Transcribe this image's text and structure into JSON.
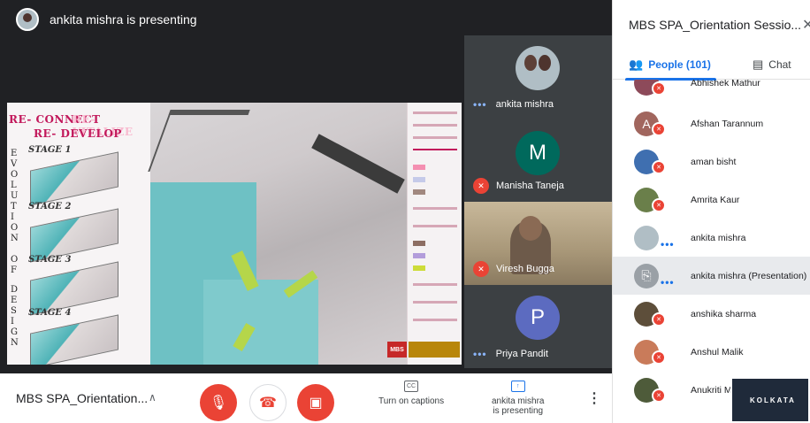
{
  "presenter": {
    "text": "ankita mishra is presenting"
  },
  "slide": {
    "title_line1a": "RE- CONNECT",
    "title_line1b": "RE- VITALIZE",
    "title_line2": "RE- DEVELOP",
    "vertical_letters": [
      "E",
      "V",
      "O",
      "L",
      "U",
      "T",
      "I",
      "O",
      "N",
      "O",
      "F",
      "D",
      "E",
      "S",
      "I",
      "G",
      "N"
    ],
    "stages": [
      "STAGE 1",
      "STAGE 2",
      "STAGE 3",
      "STAGE 4"
    ],
    "logo_text": "MBS"
  },
  "tiles": [
    {
      "name": "ankita mishra",
      "kind": "photo",
      "status": "dots"
    },
    {
      "name": "Manisha Taneja",
      "kind": "letter",
      "letter": "M",
      "color": "#00695c",
      "status": "muted"
    },
    {
      "name": "Viresh Bugga",
      "kind": "video",
      "status": "muted"
    },
    {
      "name": "Priya Pandit",
      "kind": "letter",
      "letter": "P",
      "color": "#5c6bc0",
      "status": "dots"
    }
  ],
  "side": {
    "title": "MBS SPA_Orientation Sessio...",
    "close_icon": "close-icon",
    "tab_people": "People (101)",
    "tab_chat": "Chat",
    "participants": [
      {
        "name": "Abhishek Mathur",
        "avatar_color": "#8d4a5a",
        "initial": "",
        "status": "muted"
      },
      {
        "name": "Afshan Tarannum",
        "avatar_color": "#a1665e",
        "initial": "A",
        "status": "muted"
      },
      {
        "name": "aman bisht",
        "avatar_color": "#3f6fb0",
        "initial": "",
        "status": "muted"
      },
      {
        "name": "Amrita Kaur",
        "avatar_color": "#6a7f4a",
        "initial": "",
        "status": "muted"
      },
      {
        "name": "ankita mishra",
        "avatar_color": "#b0bec5",
        "initial": "",
        "status": "dots"
      },
      {
        "name": "ankita mishra (Presentation)",
        "avatar_color": "#9aa0a6",
        "initial": "⎘",
        "status": "dots"
      },
      {
        "name": "anshika sharma",
        "avatar_color": "#5d4e3a",
        "initial": "",
        "status": "muted"
      },
      {
        "name": "Anshul Malik",
        "avatar_color": "#c97b5a",
        "initial": "",
        "status": "muted"
      },
      {
        "name": "Anukriti Ma",
        "avatar_color": "#4e5b3a",
        "initial": "",
        "status": "muted"
      }
    ]
  },
  "thumbnail": {
    "text": "KOLKATA"
  },
  "bottom": {
    "meeting_name": "MBS SPA_Orientation...",
    "captions_label": "Turn on captions",
    "captions_icon": "CC",
    "presenting_label_1": "ankita mishra",
    "presenting_label_2": "is presenting"
  },
  "colors": {
    "accent": "#1a73e8",
    "danger": "#ea4335",
    "stage_bg": "#202124"
  }
}
